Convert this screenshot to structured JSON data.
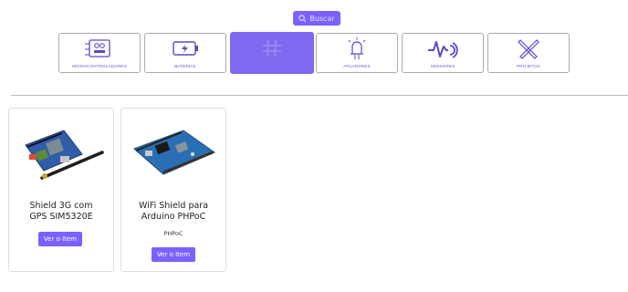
{
  "search": {
    "label": "Buscar"
  },
  "categories": [
    {
      "label": "Microcontroladores",
      "icon": "microcontroller-icon"
    },
    {
      "label": "Baterias",
      "icon": "battery-icon"
    },
    {
      "label": "",
      "icon": "hashtag-icon",
      "active": true
    },
    {
      "label": "Atuadores",
      "icon": "led-icon"
    },
    {
      "label": "Sensores",
      "icon": "sensor-wave-icon"
    },
    {
      "label": "Projetos",
      "icon": "tools-icon"
    }
  ],
  "items": [
    {
      "title_line1": "Shield 3G com",
      "title_line2": "GPS SIM5320E",
      "subtitle": "",
      "button": "Ver o Item"
    },
    {
      "title_line1": "WiFi Shield para",
      "title_line2": "Arduino PHPoC",
      "subtitle": "PHPoC",
      "button": "Ver o Item"
    }
  ],
  "colors": {
    "accent": "#7b61ff",
    "active_tile": "#8068f0",
    "label": "#6a56d8"
  }
}
